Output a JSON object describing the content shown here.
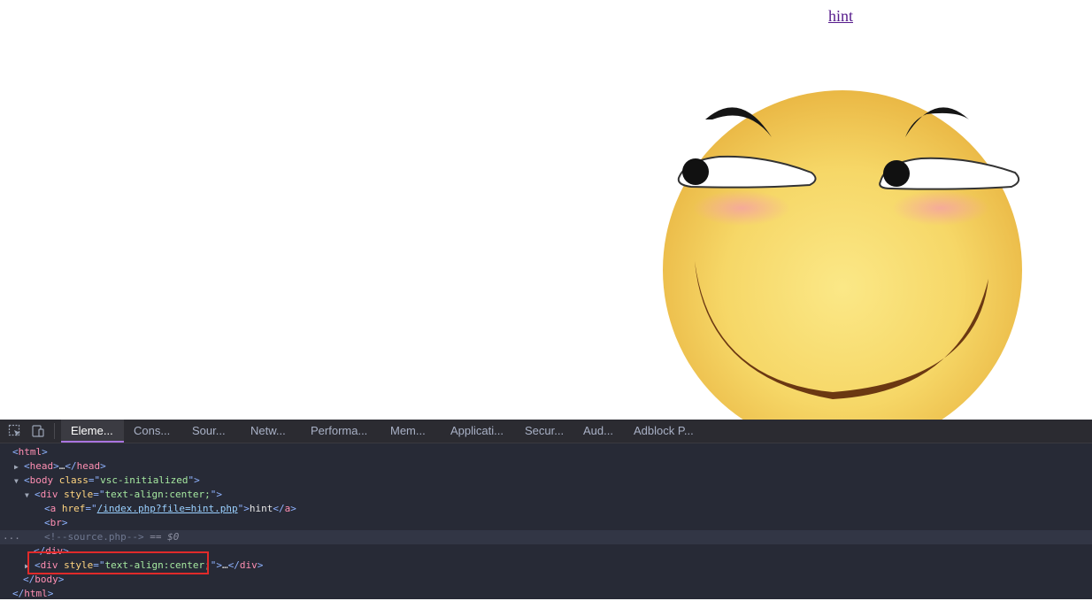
{
  "page": {
    "hint_link": "hint"
  },
  "devtools": {
    "tabs": [
      "Eleme...",
      "Cons...",
      "Sour...",
      "Netw...",
      "Performa...",
      "Mem...",
      "Applicati...",
      "Secur...",
      "Aud...",
      "Adblock P..."
    ],
    "active_tab": "Eleme...",
    "icons": [
      "inspect-element-icon",
      "device-toolbar-icon"
    ],
    "dom": {
      "html_open": "html",
      "head_tag": "head",
      "head_ellipsis": "…",
      "body_tag": "body",
      "body_class_attr": "class",
      "body_class_val": "vsc-initialized",
      "div_tag": "div",
      "div_style_attr": "style",
      "div_style_val": "text-align:center;",
      "a_tag": "a",
      "a_href_attr": "href",
      "a_href_val": "/index.php?file=hint.php",
      "a_text": "hint",
      "br_tag": "br",
      "comment": "<!--source.php-->",
      "eq_marker": "== $0",
      "div2_ellipsis": "…",
      "body_close": "body",
      "html_close": "html",
      "gutter_ellipsis": "..."
    },
    "accent_color": "#a974e0",
    "highlight_color": "#e02a2a"
  }
}
